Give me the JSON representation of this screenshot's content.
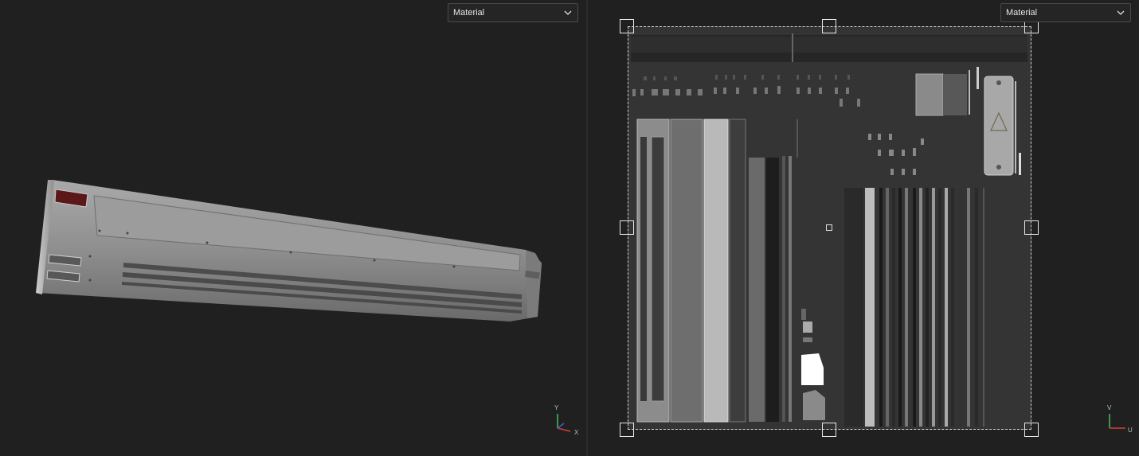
{
  "left_viewport": {
    "material_dropdown": {
      "selected": "Material"
    },
    "axis": {
      "y_label": "Y",
      "x_label": "X"
    }
  },
  "right_viewport": {
    "material_dropdown": {
      "selected": "Material"
    },
    "axis": {
      "v_label": "V",
      "u_label": "U"
    }
  },
  "colors": {
    "background": "#202020",
    "axis_red": "#d04040",
    "axis_green": "#40c060",
    "axis_blue": "#4060e0"
  },
  "icons": [
    "chevron-down-icon",
    "axis-gizmo-icon",
    "uv-axis-gizmo-icon"
  ]
}
